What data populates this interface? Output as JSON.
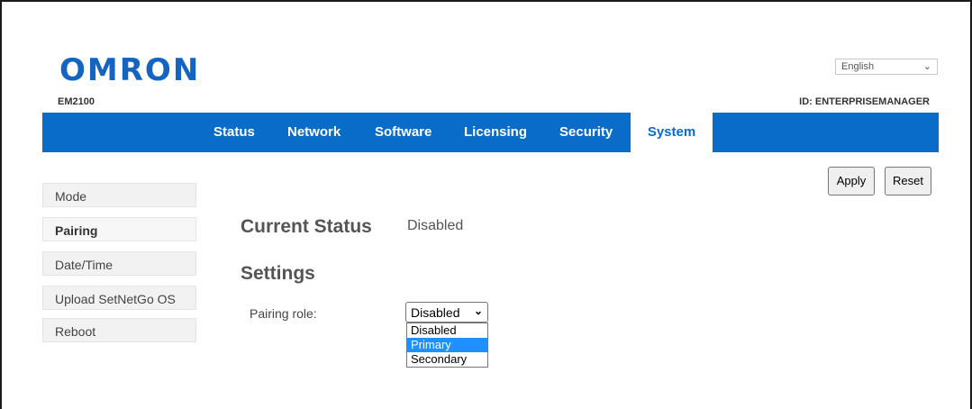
{
  "header": {
    "logo_text": "OMRON",
    "model": "EM2100",
    "device_id": "ID: ENTERPRISEMANAGER",
    "language": {
      "selected": "English"
    }
  },
  "nav": {
    "tabs": [
      {
        "label": "Status"
      },
      {
        "label": "Network"
      },
      {
        "label": "Software"
      },
      {
        "label": "Licensing"
      },
      {
        "label": "Security"
      },
      {
        "label": "System",
        "active": true
      }
    ]
  },
  "sidebar": {
    "items": [
      {
        "label": "Mode"
      },
      {
        "label": "Pairing",
        "active": true
      },
      {
        "label": "Date/Time"
      },
      {
        "label": "Upload SetNetGo OS"
      },
      {
        "label": "Reboot"
      }
    ]
  },
  "actions": {
    "apply_label": "Apply",
    "reset_label": "Reset"
  },
  "main": {
    "current_status_heading": "Current Status",
    "current_status_value": "Disabled",
    "settings_heading": "Settings",
    "pairing_role_label": "Pairing role:",
    "pairing_role_value": "Disabled",
    "pairing_role_options": [
      "Disabled",
      "Primary",
      "Secondary"
    ],
    "highlighted_option": "Primary"
  },
  "colors": {
    "brand": "#0a6cc9",
    "logo": "#1565c0",
    "highlight": "#1e90ff"
  },
  "icons": {
    "dropdown": "chevron-down-icon"
  }
}
